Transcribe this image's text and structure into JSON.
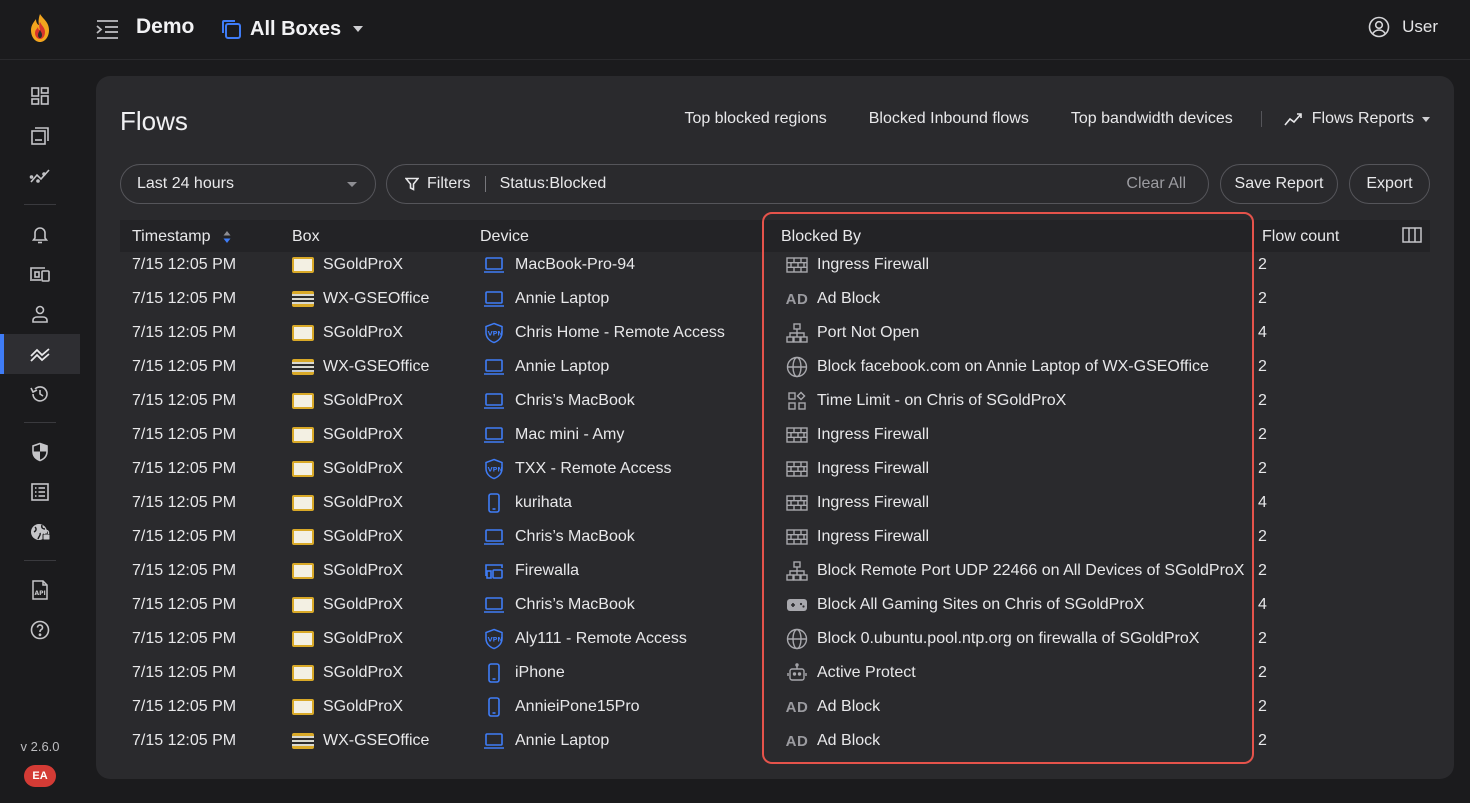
{
  "header": {
    "network_name": "Demo",
    "box_selector": "All Boxes",
    "user_label": "User"
  },
  "sidebar": {
    "items": [
      {
        "name": "dashboard-icon"
      },
      {
        "name": "boxes-icon"
      },
      {
        "name": "trends-icon"
      },
      {
        "name": "alarms-icon"
      },
      {
        "name": "devices-icon"
      },
      {
        "name": "users-icon"
      },
      {
        "name": "flows-icon",
        "active": true
      },
      {
        "name": "history-icon"
      },
      {
        "name": "rules-icon"
      },
      {
        "name": "audit-log-icon"
      },
      {
        "name": "network-security-icon"
      },
      {
        "name": "api-icon"
      },
      {
        "name": "help-icon"
      }
    ],
    "version": "v 2.6.0",
    "badge": "EA"
  },
  "page": {
    "title": "Flows",
    "quick_links": [
      "Top blocked regions",
      "Blocked Inbound flows",
      "Top bandwidth devices"
    ],
    "reports_label": "Flows Reports"
  },
  "controls": {
    "time_range": "Last 24 hours",
    "filters_label": "Filters",
    "filter_value": "Status:Blocked",
    "clear_all": "Clear All",
    "save_report": "Save Report",
    "export": "Export"
  },
  "table": {
    "headers": {
      "timestamp": "Timestamp",
      "box": "Box",
      "device": "Device",
      "blocked_by": "Blocked By",
      "flow_count": "Flow count"
    },
    "rows": [
      {
        "timestamp": "7/15 12:05 PM",
        "box": "SGoldProX",
        "box_type": "gold",
        "device": "MacBook-Pro-94",
        "device_icon": "laptop",
        "blocked_by": "Ingress Firewall",
        "blocked_icon": "firewall",
        "count": "2"
      },
      {
        "timestamp": "7/15 12:05 PM",
        "box": "WX-GSEOffice",
        "box_type": "wx",
        "device": "Annie Laptop",
        "device_icon": "laptop",
        "blocked_by": "Ad Block",
        "blocked_icon": "ad",
        "count": "2"
      },
      {
        "timestamp": "7/15 12:05 PM",
        "box": "SGoldProX",
        "box_type": "gold",
        "device": "Chris Home - Remote Access",
        "device_icon": "vpn",
        "blocked_by": "Port Not Open",
        "blocked_icon": "network",
        "count": "4"
      },
      {
        "timestamp": "7/15 12:05 PM",
        "box": "WX-GSEOffice",
        "box_type": "wx",
        "device": "Annie Laptop",
        "device_icon": "laptop",
        "blocked_by": "Block facebook.com on Annie Laptop of WX-GSEOffice",
        "blocked_icon": "globe",
        "count": "2"
      },
      {
        "timestamp": "7/15 12:05 PM",
        "box": "SGoldProX",
        "box_type": "gold",
        "device": "Chris’s MacBook",
        "device_icon": "laptop",
        "blocked_by": "Time Limit - on Chris of SGoldProX",
        "blocked_icon": "apps",
        "count": "2"
      },
      {
        "timestamp": "7/15 12:05 PM",
        "box": "SGoldProX",
        "box_type": "gold",
        "device": "Mac mini - Amy",
        "device_icon": "laptop",
        "blocked_by": "Ingress Firewall",
        "blocked_icon": "firewall",
        "count": "2"
      },
      {
        "timestamp": "7/15 12:05 PM",
        "box": "SGoldProX",
        "box_type": "gold",
        "device": "TXX - Remote Access",
        "device_icon": "vpn",
        "blocked_by": "Ingress Firewall",
        "blocked_icon": "firewall",
        "count": "2"
      },
      {
        "timestamp": "7/15 12:05 PM",
        "box": "SGoldProX",
        "box_type": "gold",
        "device": "kurihata",
        "device_icon": "phone",
        "blocked_by": "Ingress Firewall",
        "blocked_icon": "firewall",
        "count": "4"
      },
      {
        "timestamp": "7/15 12:05 PM",
        "box": "SGoldProX",
        "box_type": "gold",
        "device": "Chris’s MacBook",
        "device_icon": "laptop",
        "blocked_by": "Ingress Firewall",
        "blocked_icon": "firewall",
        "count": "2"
      },
      {
        "timestamp": "7/15 12:05 PM",
        "box": "SGoldProX",
        "box_type": "gold",
        "device": "Firewalla",
        "device_icon": "firewalla",
        "blocked_by": "Block Remote Port UDP 22466 on All Devices of SGoldProX",
        "blocked_icon": "network",
        "count": "2"
      },
      {
        "timestamp": "7/15 12:05 PM",
        "box": "SGoldProX",
        "box_type": "gold",
        "device": "Chris’s MacBook",
        "device_icon": "laptop",
        "blocked_by": "Block All Gaming Sites on Chris of SGoldProX",
        "blocked_icon": "gaming",
        "count": "4"
      },
      {
        "timestamp": "7/15 12:05 PM",
        "box": "SGoldProX",
        "box_type": "gold",
        "device": "Aly111 - Remote Access",
        "device_icon": "vpn",
        "blocked_by": "Block 0.ubuntu.pool.ntp.org on firewalla of SGoldProX",
        "blocked_icon": "globe",
        "count": "2"
      },
      {
        "timestamp": "7/15 12:05 PM",
        "box": "SGoldProX",
        "box_type": "gold",
        "device": "iPhone",
        "device_icon": "phone",
        "blocked_by": "Active Protect",
        "blocked_icon": "robot",
        "count": "2"
      },
      {
        "timestamp": "7/15 12:05 PM",
        "box": "SGoldProX",
        "box_type": "gold",
        "device": "AnnieiPone15Pro",
        "device_icon": "phone",
        "blocked_by": "Ad Block",
        "blocked_icon": "ad",
        "count": "2"
      },
      {
        "timestamp": "7/15 12:05 PM",
        "box": "WX-GSEOffice",
        "box_type": "wx",
        "device": "Annie Laptop",
        "device_icon": "laptop",
        "blocked_by": "Ad Block",
        "blocked_icon": "ad",
        "count": "2"
      }
    ]
  },
  "colors": {
    "accent": "#3f7cf6",
    "highlight": "#e5534b",
    "panel": "#2a2a2d",
    "background": "#1b1b1d"
  }
}
